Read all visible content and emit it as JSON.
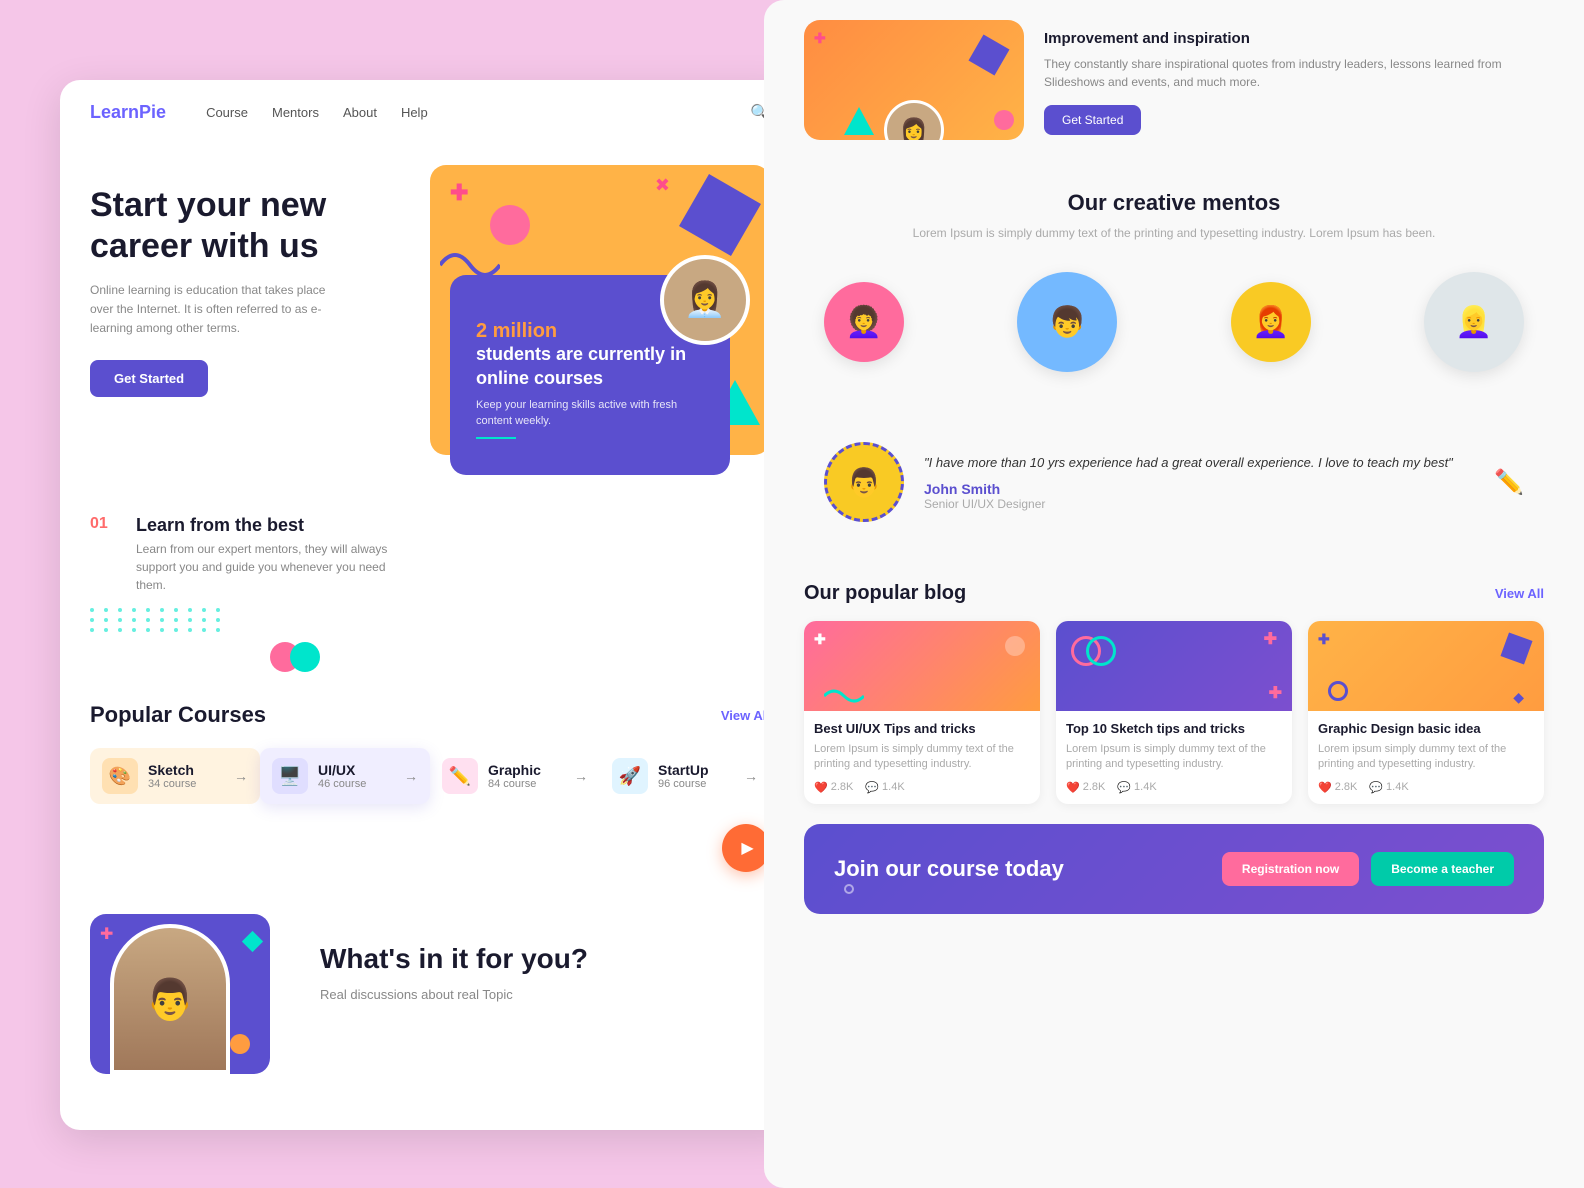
{
  "app": {
    "logo_text": "Learn",
    "logo_highlight": "Pie"
  },
  "nav": {
    "links": [
      "Course",
      "Mentors",
      "About",
      "Help"
    ]
  },
  "hero": {
    "title": "Start your new career with us",
    "description": "Online learning is education that takes place over the Internet. It is often referred to as e- learning among other terms.",
    "cta_button": "Get Started",
    "stats_highlight": "2 million",
    "stats_text": "students are currently in online courses",
    "stats_sub": "Keep your learning skills active with fresh content weekly."
  },
  "learn": {
    "number": "01",
    "title": "Learn from the best",
    "description": "Learn from our expert mentors, they will always support you and guide you whenever you need them."
  },
  "courses": {
    "section_title": "Popular Courses",
    "view_all": "View All",
    "items": [
      {
        "icon": "🎨",
        "name": "Sketch",
        "count": "34 course",
        "bg": "#fff3e0"
      },
      {
        "icon": "🖥️",
        "name": "UI/UX",
        "count": "46 course",
        "bg": "#f0eeff"
      },
      {
        "icon": "✏️",
        "name": "Graphic",
        "count": "84 course",
        "bg": "#fff"
      },
      {
        "icon": "🚀",
        "name": "StartUp",
        "count": "96 course",
        "bg": "#fff"
      }
    ]
  },
  "whats": {
    "title": "What's in it for you?",
    "description": "Real discussions about real Topic"
  },
  "right": {
    "top_heading": "Improvement and inspiration",
    "top_desc": "They constantly share inspirational quotes from industry leaders, lessons learned from Slideshows and events, and much more.",
    "top_cta": "Get Started"
  },
  "mentors": {
    "section_title": "Our creative mentos",
    "section_subtitle": "Lorem Ipsum is simply dummy text of the printing and typesetting industry. Lorem Ipsum has been.",
    "people": [
      "👦",
      "👩",
      "👩‍🦰",
      "👱‍♀️"
    ]
  },
  "testimonial": {
    "quote": "\"I have more than 10 yrs experience had a great overall experience. I love to teach my best\"",
    "name": "John Smith",
    "role": "Senior UI/UX Designer"
  },
  "blog": {
    "section_title": "Our popular blog",
    "view_all": "View All",
    "posts": [
      {
        "title": "Best UI/UX Tips and tricks",
        "desc": "Lorem Ipsum is simply dummy text of the printing and typesetting industry.",
        "likes": "2.8K",
        "comments": "1.4K",
        "img_class": "blog-img-pink"
      },
      {
        "title": "Top 10 Sketch tips and tricks",
        "desc": "Lorem Ipsum is simply dummy text of the printing and typesetting industry.",
        "likes": "2.8K",
        "comments": "1.4K",
        "img_class": "blog-img-purple"
      },
      {
        "title": "Graphic Design basic idea",
        "desc": "Lorem ipsum simply dummy text of the printing and typesetting industry.",
        "likes": "2.8K",
        "comments": "1.4K",
        "img_class": "blog-img-orange"
      }
    ]
  },
  "cta": {
    "text": "Join our course today",
    "btn1": "Registration now",
    "btn2": "Become a teacher"
  }
}
